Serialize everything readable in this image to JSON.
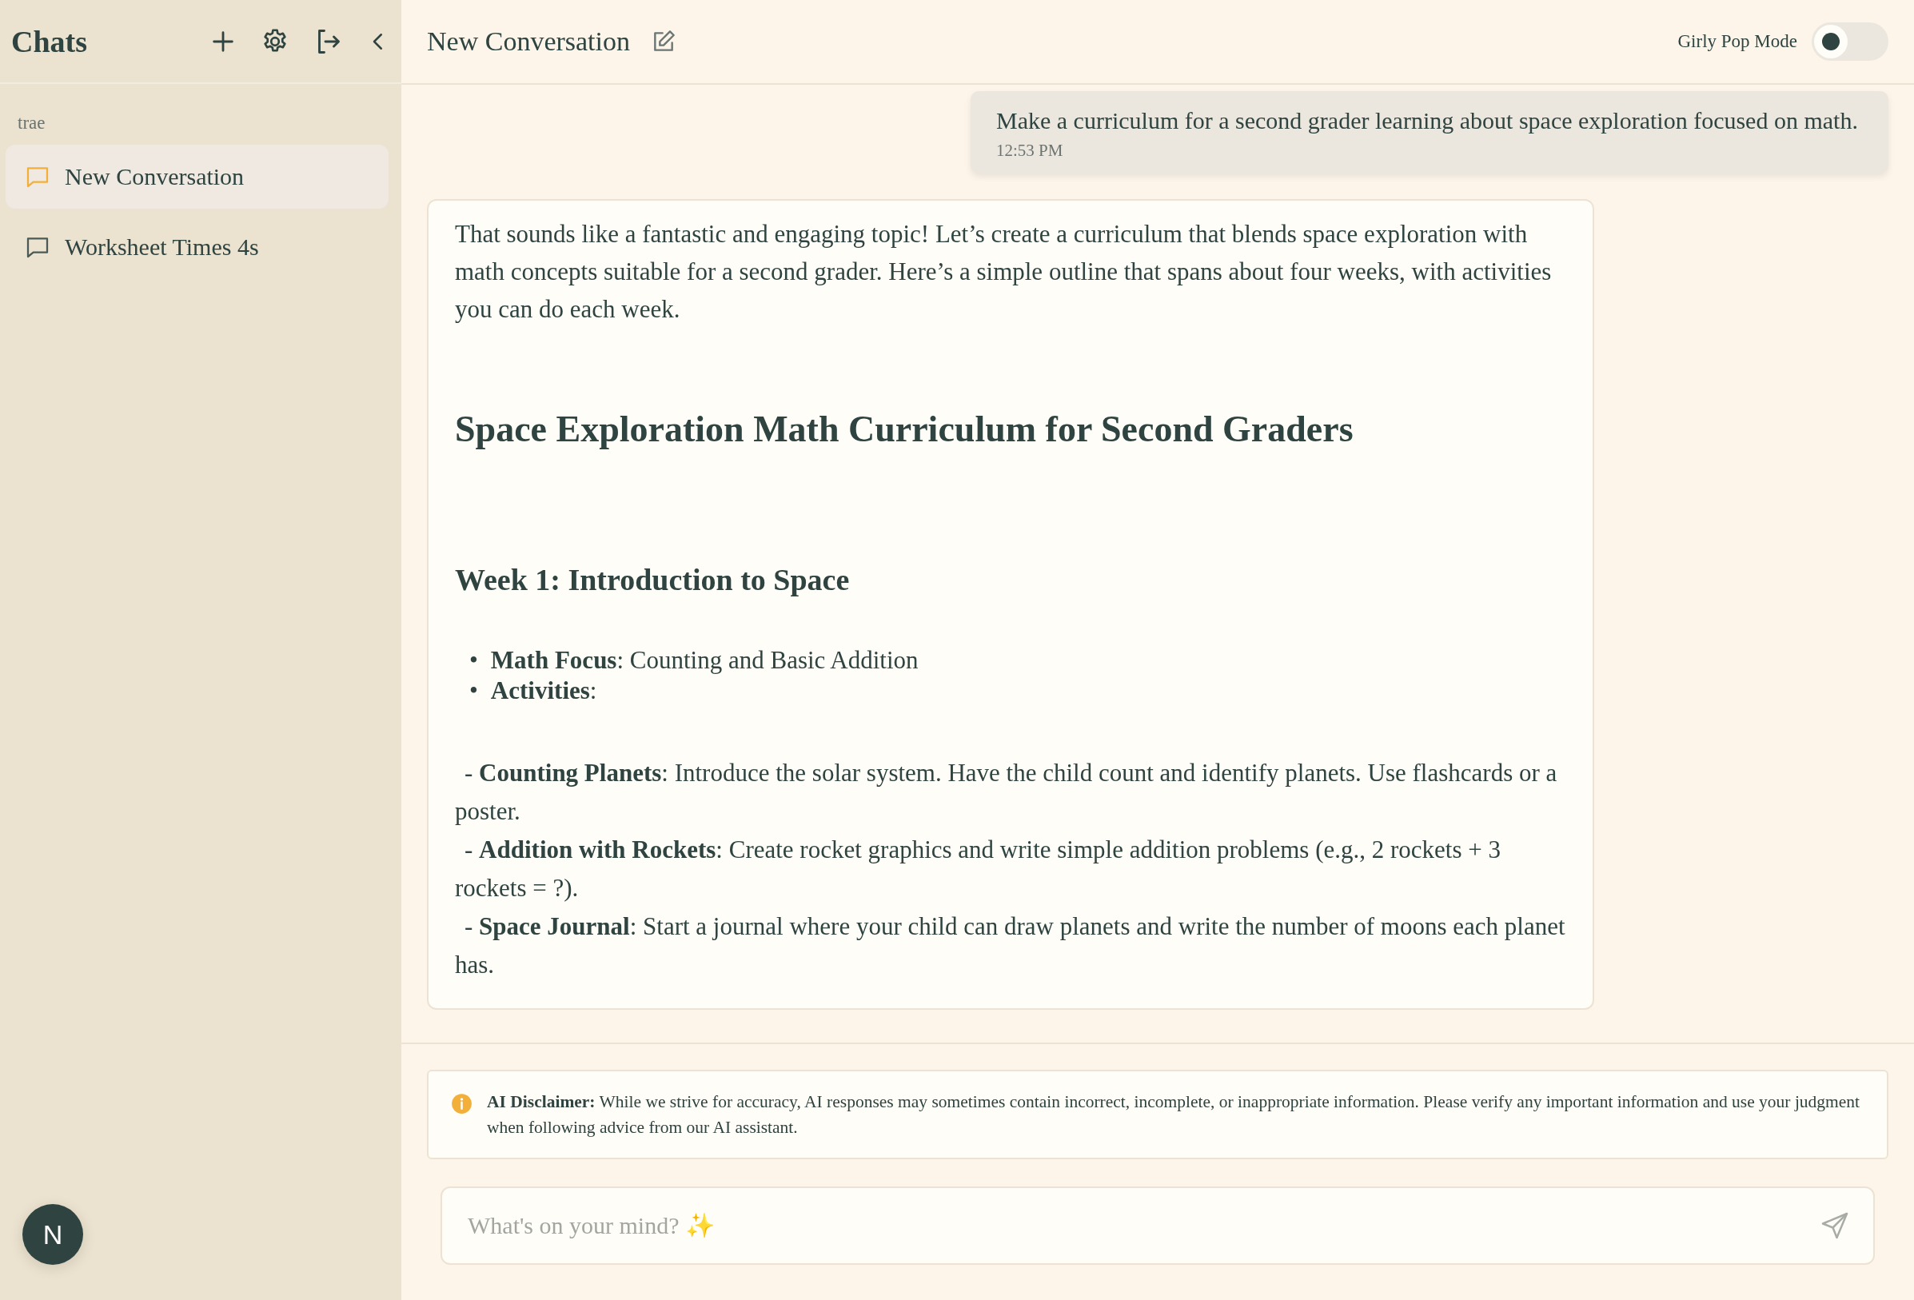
{
  "sidebar": {
    "title": "Chats",
    "user_label": "trae",
    "items": [
      {
        "label": "New Conversation",
        "selected": true
      },
      {
        "label": "Worksheet Times 4s",
        "selected": false
      }
    ],
    "avatar": "N"
  },
  "header": {
    "title": "New Conversation",
    "toggle": {
      "label": "Girly Pop Mode",
      "on": false
    }
  },
  "messages": [
    {
      "kind": "user",
      "text": "Make a curriculum for a second grader learning about space exploration focused on math.",
      "time": "12:53 PM"
    },
    {
      "kind": "assistant",
      "blocks": [
        {
          "kind": "paragraph",
          "text": "That sounds like a fantastic and engaging topic! Let’s create a curriculum that blends space exploration with math concepts suitable for a second grader. Here’s a simple outline that spans about four weeks, with activities you can do each week."
        },
        {
          "kind": "heading",
          "text": "Space Exploration Math Curriculum for Second Graders"
        },
        {
          "kind": "subheading",
          "text": "Week 1: Introduction to Space"
        },
        {
          "kind": "list",
          "items": [
            {
              "marker": "•",
              "text": "**Math Focus**: Counting and Basic Addition"
            },
            {
              "marker": "•",
              "text": "**Activities**:"
            }
          ]
        },
        {
          "kind": "activity",
          "text": "- **Counting Planets**: Introduce the solar system. Have the child count and identify planets. Use flashcards or a poster."
        },
        {
          "kind": "activity",
          "text": "- **Addition with Rockets**: Create rocket graphics and write simple addition problems (e.g., 2 rockets + 3 rockets = ?)."
        },
        {
          "kind": "activity",
          "text": "- **Space Journal**: Start a journal where your child can draw planets and write the number of moons each planet has."
        }
      ]
    }
  ],
  "disclaimer": "**AI Disclaimer:** While we strive for accuracy, AI responses may sometimes contain incorrect, incomplete, or inappropriate information. Please verify any important information and use your judgment when following advice from our AI assistant.",
  "input": {
    "placeholder": "What's on your mind? ✨"
  }
}
